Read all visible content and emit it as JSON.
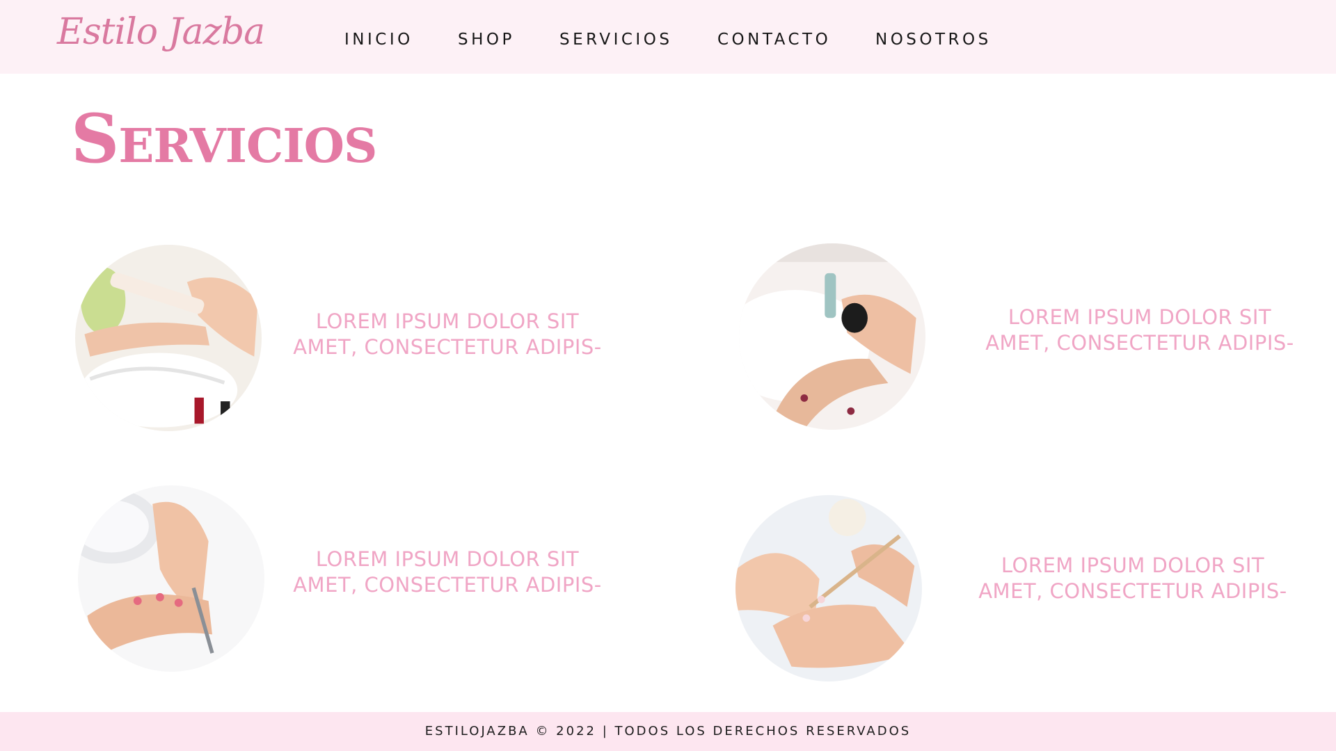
{
  "header": {
    "logo": "Estilo Jazba",
    "nav": [
      {
        "label": "INICIO"
      },
      {
        "label": "SHOP"
      },
      {
        "label": "SERVICIOS"
      },
      {
        "label": "CONTACTO"
      },
      {
        "label": "NOSOTROS"
      }
    ]
  },
  "main": {
    "title": "Servicios",
    "services": [
      {
        "line1": "LOREM IPSUM DOLOR SIT",
        "line2": "AMET, CONSECTETUR ADIPIS-",
        "image": "nail-filing-photo"
      },
      {
        "line1": "LOREM IPSUM DOLOR SIT",
        "line2": "AMET, CONSECTETUR ADIPIS-",
        "image": "nail-polish-photo"
      },
      {
        "line1": "LOREM IPSUM DOLOR SIT",
        "line2": "AMET, CONSECTETUR ADIPIS-",
        "image": "cuticle-care-photo"
      },
      {
        "line1": "LOREM IPSUM DOLOR SIT",
        "line2": "AMET, CONSECTETUR ADIPIS-",
        "image": "cuticle-stick-photo"
      }
    ]
  },
  "footer": {
    "text": "ESTILOJAZBA © 2022 | TODOS LOS DERECHOS RESERVADOS"
  },
  "colors": {
    "header_bg": "#fdf1f6",
    "accent": "#e47aa4",
    "service_text": "#f0a5c5",
    "footer_bg": "#fde6f0"
  }
}
